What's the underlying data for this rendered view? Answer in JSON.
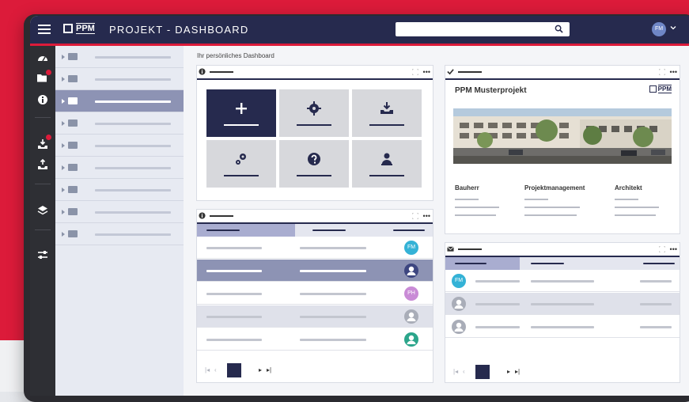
{
  "header": {
    "logo_text": "PPM",
    "title": "PROJEKT - DASHBOARD",
    "search_placeholder": "",
    "user_initials": "FM"
  },
  "dashboard": {
    "label": "Ihr persönliches Dashboard"
  },
  "project": {
    "title": "PPM Musterprojekt",
    "logo_text": "PPM",
    "columns": [
      "Bauherr",
      "Projektmanagement",
      "Architekt"
    ]
  },
  "table1": {
    "rows": [
      {
        "avatar": "FM",
        "color": "#34b2d6"
      },
      {
        "avatar": "",
        "color": "#3d4680"
      },
      {
        "avatar": "PH",
        "color": "#c98bd6"
      },
      {
        "avatar": "",
        "color": "#a9adb8"
      },
      {
        "avatar": "",
        "color": "#2ba58b"
      }
    ]
  },
  "table2": {
    "rows": [
      {
        "avatar": "FM",
        "color": "#34b2d6"
      },
      {
        "avatar": "",
        "color": "#a9adb8"
      },
      {
        "avatar": "",
        "color": "#a9adb8"
      }
    ]
  },
  "colors": {
    "navy": "#262a4e",
    "red": "#dc1b3a",
    "active": "#8d93b4"
  }
}
